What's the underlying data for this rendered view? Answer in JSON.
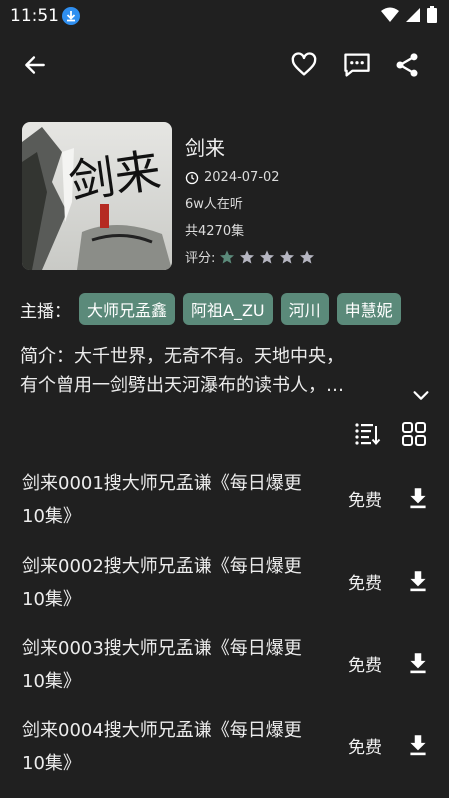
{
  "status": {
    "time": "11:51"
  },
  "book": {
    "title": "剑来",
    "date": "2024-07-02",
    "listeners": "6w人在听",
    "episodes_count": "共4270集",
    "rating_label": "评分:",
    "rating_stars": 1,
    "rating_max": 5
  },
  "hosts": {
    "label": "主播：",
    "items": [
      "大师兄孟鑫",
      "阿祖A_ZU",
      "河川",
      "申慧妮"
    ]
  },
  "intro": {
    "line1": "简介：大千世界，无奇不有。天地中央，",
    "line2": "有个曾用一剑劈出天河瀑布的读书人，…"
  },
  "episodes": [
    {
      "title_line1": "剑来0001搜大师兄孟谦《每日爆更",
      "title_line2": "10集》",
      "price": "免费"
    },
    {
      "title_line1": "剑来0002搜大师兄孟谦《每日爆更",
      "title_line2": "10集》",
      "price": "免费"
    },
    {
      "title_line1": "剑来0003搜大师兄孟谦《每日爆更",
      "title_line2": "10集》",
      "price": "免费"
    },
    {
      "title_line1": "剑来0004搜大师兄孟谦《每日爆更",
      "title_line2": "10集》",
      "price": "免费"
    }
  ],
  "cover_text": {
    "main": "剑来"
  },
  "colors": {
    "accent": "#5b8a7a",
    "background": "#202020",
    "star_on": "#5b8a7a",
    "star_off": "#b5b5c0"
  },
  "icons": [
    "download-icon",
    "wifi-icon",
    "signal-icon",
    "battery-icon",
    "back-arrow-icon",
    "heart-icon",
    "comment-icon",
    "share-icon",
    "clock-icon",
    "star-icon",
    "chevron-down-icon",
    "sort-list-icon",
    "grid-view-icon"
  ]
}
